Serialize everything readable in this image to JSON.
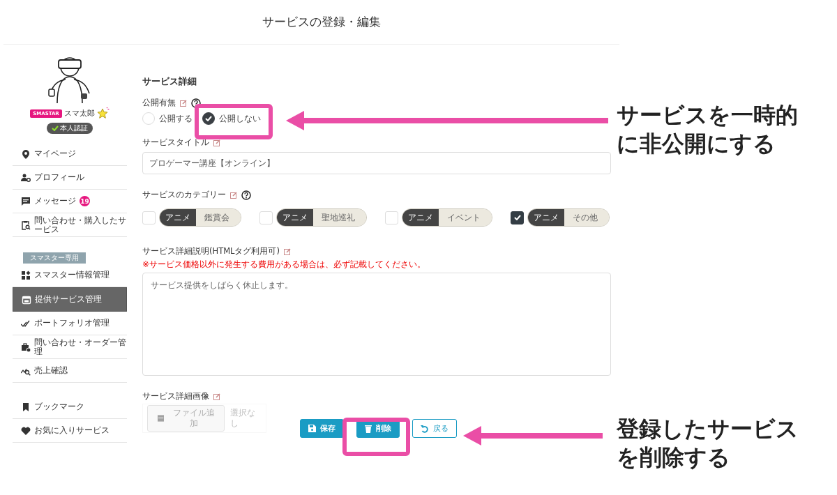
{
  "page_title": "サービスの登録・編集",
  "profile": {
    "badge": "SMASTAR",
    "name": "スマ太郎",
    "verified": "本人認証"
  },
  "sidebar": {
    "groups": [
      {
        "items": [
          {
            "label": "マイページ",
            "selected": false
          },
          {
            "label": "プロフィール",
            "selected": false
          },
          {
            "label": "メッセージ",
            "selected": false,
            "count": "19"
          },
          {
            "label": "問い合わせ・購入したサービス",
            "selected": false
          }
        ]
      },
      {
        "heading": "スマスター専用",
        "items": [
          {
            "label": "スマスター情報管理",
            "selected": false
          },
          {
            "label": "提供サービス管理",
            "selected": true
          },
          {
            "label": "ポートフォリオ管理",
            "selected": false
          },
          {
            "label": "問い合わせ・オーダー管理",
            "selected": false
          },
          {
            "label": "売上確認",
            "selected": false
          }
        ]
      },
      {
        "items": [
          {
            "label": "ブックマーク",
            "selected": false
          },
          {
            "label": "お気に入りサービス",
            "selected": false
          }
        ]
      }
    ]
  },
  "form": {
    "section_title": "サービス詳細",
    "publish": {
      "label": "公開有無",
      "options": [
        {
          "label": "公開する",
          "selected": false
        },
        {
          "label": "公開しない",
          "selected": true
        }
      ]
    },
    "title_field": {
      "label": "サービスタイトル",
      "value": "プロゲーマー講座【オンライン】"
    },
    "category": {
      "label": "サービスのカテゴリー",
      "options": [
        {
          "group": "アニメ",
          "label": "鑑賞会",
          "checked": false
        },
        {
          "group": "アニメ",
          "label": "聖地巡礼",
          "checked": false
        },
        {
          "group": "アニメ",
          "label": "イベント",
          "checked": false
        },
        {
          "group": "アニメ",
          "label": "その他",
          "checked": true
        }
      ]
    },
    "description": {
      "label": "サービス詳細説明(HTMLタグ利用可)",
      "note": "※サービス価格以外に発生する費用がある場合は、必ず記載してください。",
      "value": "サービス提供をしばらく休止します。"
    },
    "image": {
      "label": "サービス詳細画像",
      "button": "ファイル追加",
      "status": "選択なし"
    },
    "buttons": [
      {
        "label": "保存",
        "kind": "save"
      },
      {
        "label": "削除",
        "kind": "delete"
      },
      {
        "label": "戻る",
        "kind": "back"
      }
    ]
  },
  "annotations": [
    {
      "lines": [
        "サービスを一時的",
        "に非公開にする"
      ]
    },
    {
      "lines": [
        "登録したサービス",
        "を削除する"
      ]
    }
  ]
}
